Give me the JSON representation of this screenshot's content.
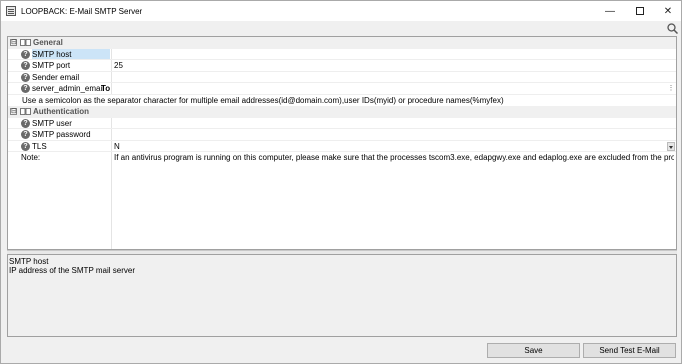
{
  "window": {
    "title": "LOOPBACK: E-Mail SMTP Server"
  },
  "controls": {
    "minimize": "—",
    "maximize": "",
    "close": "✕"
  },
  "grid": {
    "categories": [
      {
        "label": "General",
        "expander": "⊟"
      },
      {
        "label": "Authentication",
        "expander": "⊟"
      }
    ],
    "general_rows": [
      {
        "label": "SMTP host",
        "value": ""
      },
      {
        "label": "SMTP port",
        "value": "25"
      },
      {
        "label": "Sender email",
        "value": ""
      },
      {
        "label": "server_admin_email",
        "to": "To",
        "value": ""
      }
    ],
    "hint": "Use a semicolon as the separator character for multiple email addresses(id@domain.com),user IDs(myid) or procedure names(%myfex)",
    "auth_rows": [
      {
        "label": "SMTP user",
        "value": ""
      },
      {
        "label": "SMTP password",
        "value": ""
      },
      {
        "label": "TLS",
        "value": "N"
      }
    ],
    "note": {
      "label": "Note:",
      "value": "If an antivirus program is running on this computer, please make sure that the processes tscom3.exe, edapgwy.exe and edaplog.exe are excluded from the processes which are ..."
    }
  },
  "description": {
    "title": "SMTP host",
    "text": "IP address of the SMTP mail server"
  },
  "buttons": {
    "save": "Save",
    "send_test": "Send Test E-Mail"
  }
}
